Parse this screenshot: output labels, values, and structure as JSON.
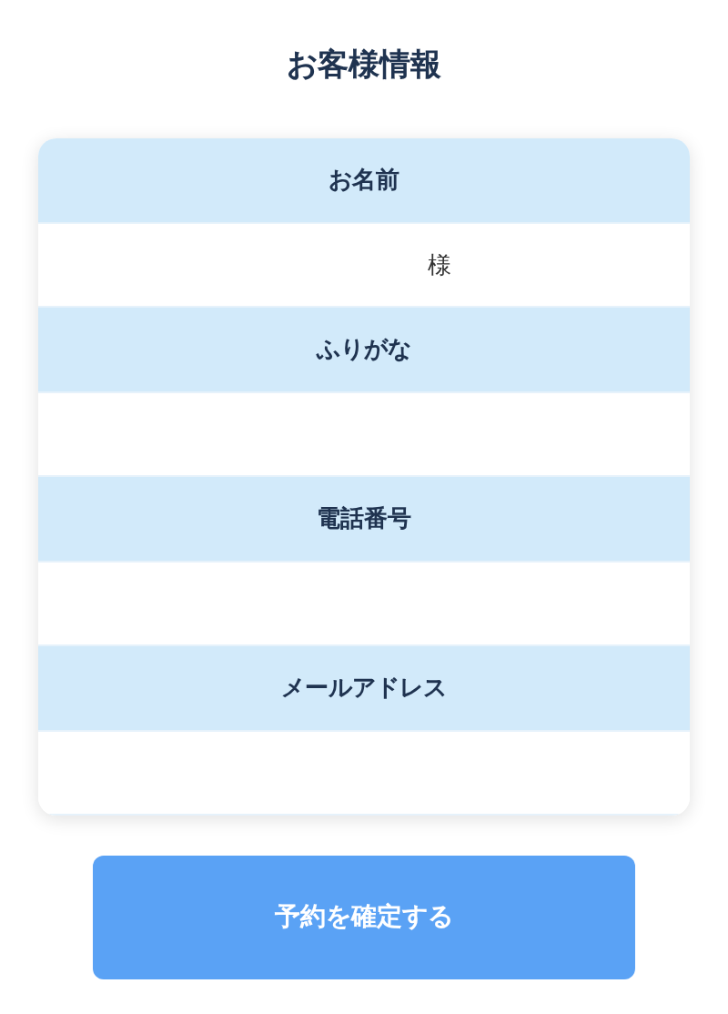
{
  "title": "お客様情報",
  "fields": [
    {
      "label": "お名前",
      "suffix": "様"
    },
    {
      "label": "ふりがな"
    },
    {
      "label": "電話番号"
    },
    {
      "label": "メールアドレス"
    }
  ],
  "submit_button": "予約を確定する"
}
